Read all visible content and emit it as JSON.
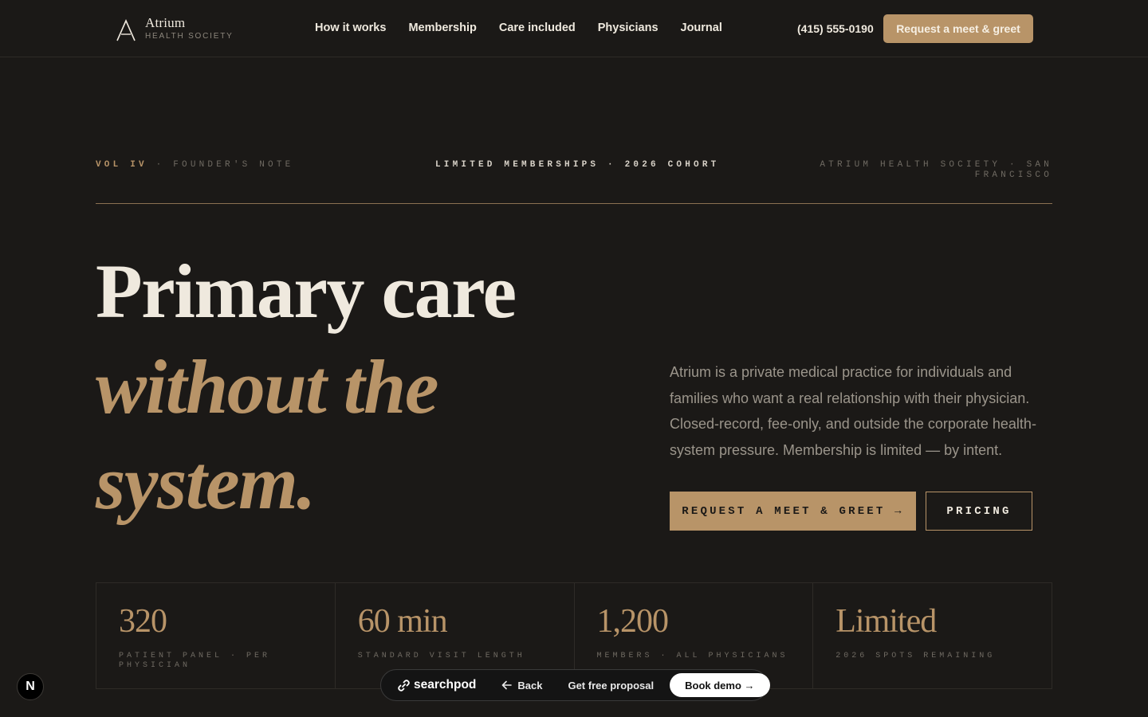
{
  "nav": {
    "brand_name": "Atrium",
    "brand_sub": "HEALTH SOCIETY",
    "links": [
      "How it works",
      "Membership",
      "Care included",
      "Physicians",
      "Journal"
    ],
    "phone": "(415) 555-0190",
    "cta": "Request a meet & greet"
  },
  "meta": {
    "left_vol": "VOL IV",
    "left_note": " · FOUNDER'S NOTE",
    "center": "LIMITED MEMBERSHIPS · 2026 COHORT",
    "right": "ATRIUM HEALTH SOCIETY · SAN FRANCISCO"
  },
  "hero": {
    "line1": "Primary care",
    "line2": "without the",
    "line3": "system.",
    "lede": "Atrium is a private medical practice for individuals and families who want a real relationship with their physician. Closed-record, fee-only, and outside the corporate health-system pressure. Membership is limited — by intent.",
    "primary_cta": "REQUEST A MEET & GREET →",
    "secondary_cta": "PRICING"
  },
  "stats": [
    {
      "value": "320",
      "label": "PATIENT PANEL · PER PHYSICIAN"
    },
    {
      "value": "60 min",
      "label": "STANDARD VISIT LENGTH"
    },
    {
      "value": "1,200",
      "label": "MEMBERS · ALL PHYSICIANS"
    },
    {
      "value": "Limited",
      "label": "2026 SPOTS REMAINING"
    }
  ],
  "toolbar": {
    "logo": "searchpod",
    "back": "Back",
    "proposal": "Get free proposal",
    "demo": "Book demo →"
  },
  "badge": "N",
  "colors": {
    "background": "#1b1917",
    "accent": "#b89468",
    "text": "#efe9de",
    "muted": "#9b958b"
  }
}
